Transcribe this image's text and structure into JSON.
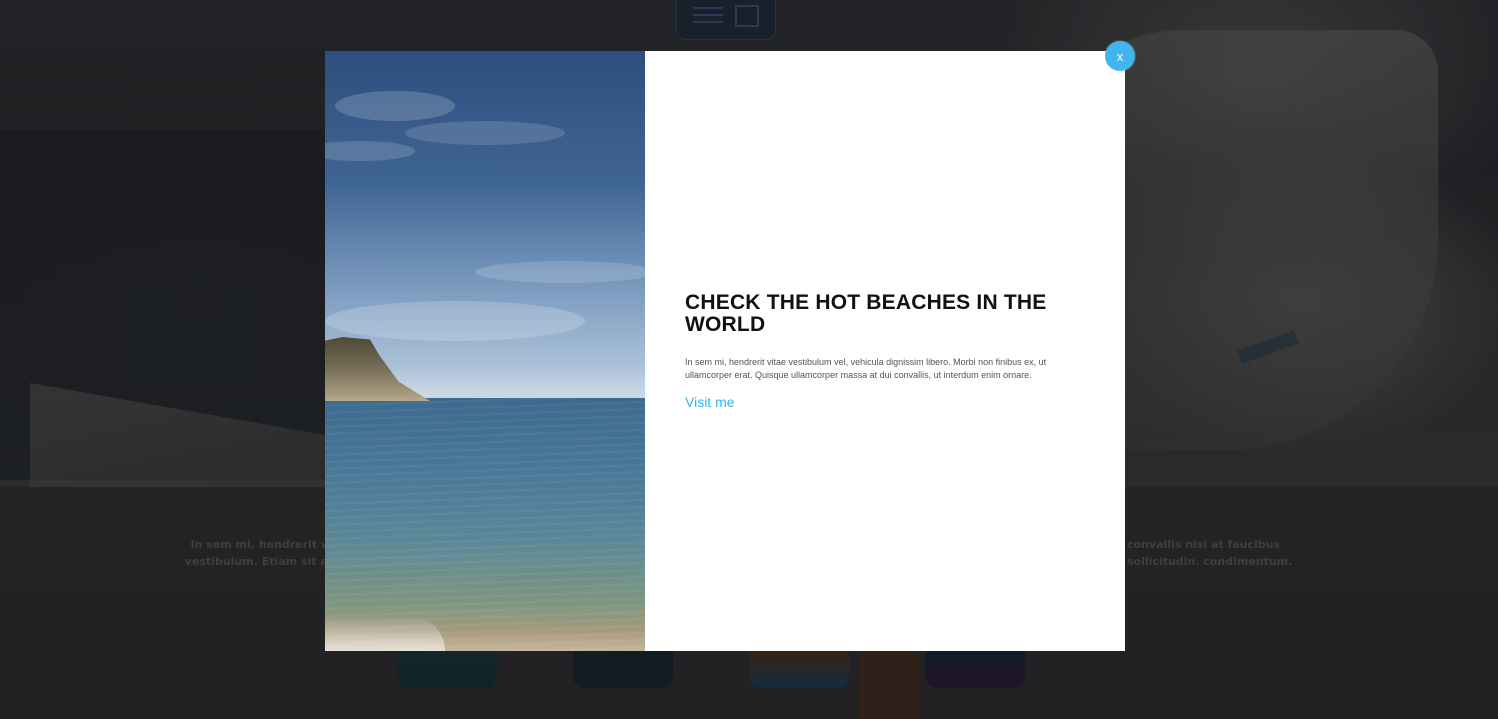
{
  "background": {
    "left_text": "In sem mi, hendrerit vitae vestibulum. Etiam sit amet",
    "right_text": "convallis nisi at faucibus sollicitudin. condimentum."
  },
  "modal": {
    "title": "CHECK THE HOT BEACHES IN THE WORLD",
    "body": "In sem mi, hendrerit vitae vestibulum vel, vehicula dignissim libero. Morbi non finibus ex, ut ullamcorper erat. Quisque ullamcorper massa at dui convallis, ut interdum enim ornare.",
    "link_label": "Visit me",
    "close_label": "x",
    "image_icon": "beach-photo",
    "accent_color": "#3fb6f0",
    "link_color": "#2bb8f3"
  }
}
